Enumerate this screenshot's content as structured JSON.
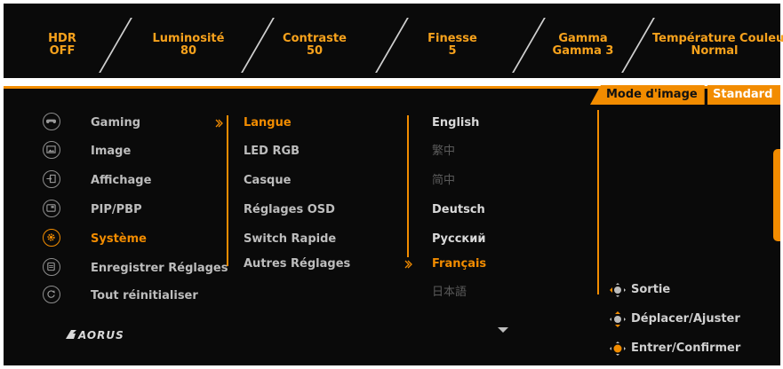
{
  "top_bar": {
    "items": [
      {
        "label": "HDR",
        "value": "OFF"
      },
      {
        "label": "Luminosité",
        "value": "80"
      },
      {
        "label": "Contraste",
        "value": "50"
      },
      {
        "label": "Finesse",
        "value": "5"
      },
      {
        "label": "Gamma",
        "value": "Gamma 3"
      },
      {
        "label": "Température Couleur",
        "value": "Normal"
      }
    ]
  },
  "picture_mode": {
    "label": "Mode d'image",
    "value": "Standard"
  },
  "main_menu": [
    {
      "label": "Gaming",
      "icon": "gamepad-icon"
    },
    {
      "label": "Image",
      "icon": "picture-icon"
    },
    {
      "label": "Affichage",
      "icon": "input-icon"
    },
    {
      "label": "PIP/PBP",
      "icon": "pip-icon"
    },
    {
      "label": "Système",
      "icon": "gear-icon",
      "active": true
    },
    {
      "label": "Enregistrer Réglages",
      "icon": "save-icon"
    },
    {
      "label": "Tout réinitialiser",
      "icon": "reset-icon"
    }
  ],
  "sub_menu": [
    "Langue",
    "LED RGB",
    "Casque",
    "Réglages OSD",
    "Switch Rapide",
    "Autres Réglages"
  ],
  "options": [
    "English",
    "繁中",
    "简中",
    "Deutsch",
    "Русский",
    "Français",
    "日本語"
  ],
  "hints": [
    {
      "label": "Sortie",
      "icon": "joystick-left-icon"
    },
    {
      "label": "Déplacer/Ajuster",
      "icon": "joystick-updown-icon"
    },
    {
      "label": "Entrer/Confirmer",
      "icon": "joystick-press-icon"
    }
  ],
  "brand": "AORUS",
  "colors": {
    "accent": "#f28c00",
    "background": "#0a0a0a",
    "text": "#bdbdbd"
  }
}
